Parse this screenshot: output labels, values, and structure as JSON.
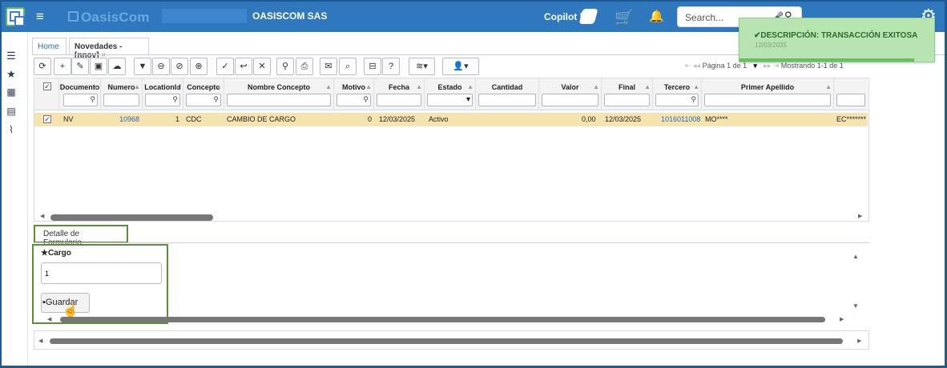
{
  "header": {
    "brand": "OasisCom",
    "company": "OASISCOM SAS",
    "copilot": "Copilot |",
    "search_placeholder": "Search..."
  },
  "tabs": [
    {
      "label": "Home"
    },
    {
      "label": "Novedades -[nnov]",
      "close": "×"
    }
  ],
  "pager": {
    "page_text": "Página 1 de 1",
    "showing": "Mostrando 1-1 de 1"
  },
  "grid": {
    "columns": [
      "Documento",
      "Numero",
      "LocationId",
      "Concepto",
      "Nombre Concepto",
      "Motivo",
      "Fecha",
      "Estado",
      "Cantidad",
      "Valor",
      "Final",
      "Tercero",
      "Primer Apellido"
    ],
    "row": {
      "documento": "NV",
      "numero": "10968",
      "location": "1",
      "concepto": "CDC",
      "nombre_concepto": "CAMBIO DE CARGO",
      "motivo": "0",
      "fecha": "12/03/2025",
      "estado": "Activo",
      "valor": "0,00",
      "final": "12/03/2025",
      "tercero": "1016011008",
      "primer_apellido": "MO****",
      "extra": "EC*******"
    }
  },
  "detail": {
    "tab_label": "Detalle de Formulario",
    "cargo_label": "Cargo",
    "cargo_value": "1",
    "save_label": "Guardar"
  },
  "toast": {
    "title": "DESCRIPCIÓN: TRANSACCIÓN EXITOSA",
    "date": "12/03/2025"
  },
  "colors": {
    "topbar": "#2f78be",
    "selected_row": "#f5e3b0",
    "highlight_border": "#5a8f36",
    "toast_bg": "#b7e4b1"
  }
}
